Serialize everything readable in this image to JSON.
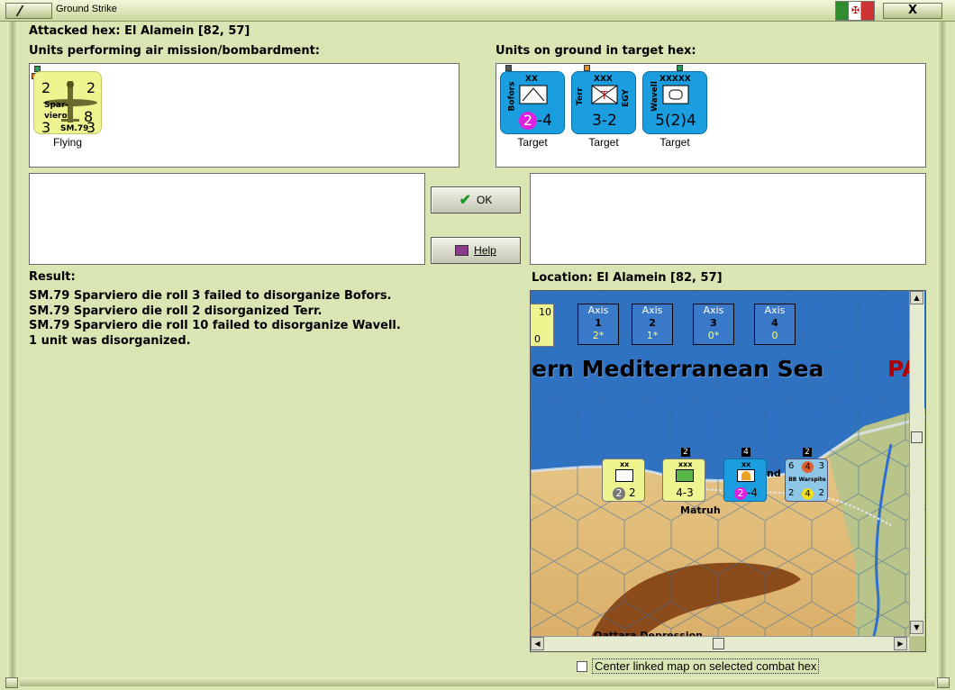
{
  "window": {
    "title": "Ground Strike",
    "close_glyph": "X"
  },
  "header": {
    "attacked_hex_label": "Attacked hex: El Alamein  [82, 57]",
    "air_units_label": "Units performing air mission/bombardment:",
    "ground_units_label": "Units on ground in target hex:"
  },
  "air_units": [
    {
      "name_line1": "Spar-",
      "name_line2": "viero",
      "type": "SM.79",
      "tl": "2",
      "tr": "2",
      "bl": "3",
      "br": "3",
      "center": "8",
      "status": "Flying"
    }
  ],
  "ground_units": [
    {
      "name": "Bofors",
      "size": "XX",
      "strength_a": "2",
      "strength_b": "-4",
      "status": "Target",
      "symbol": "aa-icon"
    },
    {
      "name": "Terr",
      "side": "EGY",
      "size": "XXX",
      "strength": "3-2",
      "status": "Target",
      "symbol": "infantry-icon"
    },
    {
      "name": "Wavell",
      "size": "XXXXX",
      "strength": "5(2)4",
      "status": "Target",
      "symbol": "hq-icon"
    }
  ],
  "buttons": {
    "ok": "OK",
    "help": "Help"
  },
  "result": {
    "label": "Result:",
    "lines": [
      "SM.79 Sparviero die roll 3 failed to disorganize Bofors.",
      "SM.79 Sparviero die roll 2 disorganized Terr.",
      "SM.79 Sparviero die roll 10 failed to disorganize Wavell.",
      "1 unit was disorganized."
    ]
  },
  "location": {
    "label": "Location:  El Alamein  [82, 57]"
  },
  "map": {
    "sea_label": "ern Mediterranean Sea",
    "edge_label": "PA",
    "town_label": "Matruh",
    "partial_label": "nd",
    "depression_label": "Qattara Depression",
    "axis_boxes": [
      {
        "label": "Axis",
        "num": "1",
        "val": "2*"
      },
      {
        "label": "Axis",
        "num": "2",
        "val": "1*"
      },
      {
        "label": "Axis",
        "num": "3",
        "val": "0*"
      },
      {
        "label": "Axis",
        "num": "4",
        "val": "0"
      }
    ],
    "stack_counts": [
      "2",
      "4",
      "2"
    ],
    "map_units": [
      {
        "size": "xx",
        "val": "2",
        "strength": "2"
      },
      {
        "size": "xxx",
        "strength": "4-3"
      },
      {
        "size": "xx",
        "val": "2",
        "strength": "-4"
      },
      {
        "name": "BB Warspite",
        "tl": "6",
        "t": "4",
        "tr": "3",
        "bl": "2",
        "b": "4",
        "br": "2"
      }
    ],
    "corner_counter": {
      "top": "10",
      "bot": "0"
    }
  },
  "checkbox": {
    "label": "Center linked map on selected combat hex",
    "checked": false
  }
}
